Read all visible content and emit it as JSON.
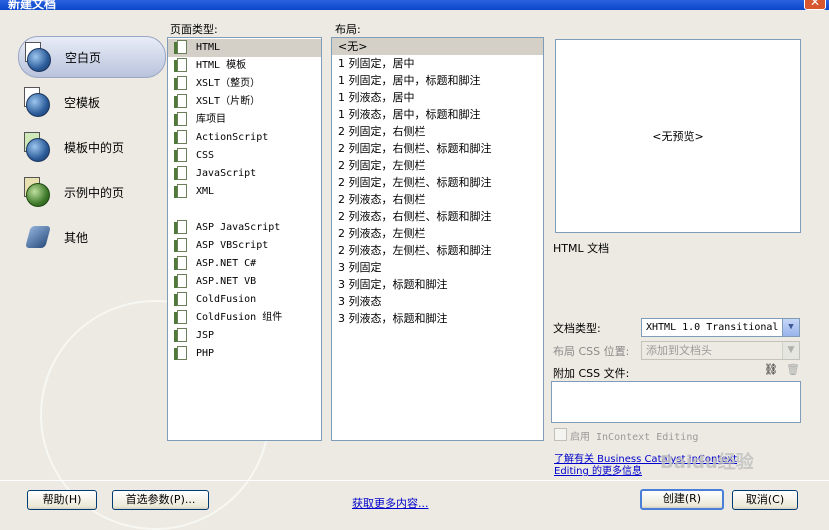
{
  "window": {
    "title": "新建文档",
    "close_glyph": "✕"
  },
  "nav": [
    {
      "label": "空白页",
      "icon": "blank-page-icon",
      "selected": true
    },
    {
      "label": "空模板",
      "icon": "blank-template-icon",
      "selected": false
    },
    {
      "label": "模板中的页",
      "icon": "page-from-template-icon",
      "selected": false
    },
    {
      "label": "示例中的页",
      "icon": "page-from-sample-icon",
      "selected": false
    },
    {
      "label": "其他",
      "icon": "other-icon",
      "selected": false
    }
  ],
  "page_type": {
    "label": "页面类型:",
    "items": [
      "HTML",
      "HTML 模板",
      "XSLT（整页）",
      "XSLT（片断）",
      "库项目",
      "ActionScript",
      "CSS",
      "JavaScript",
      "XML",
      "",
      "ASP JavaScript",
      "ASP VBScript",
      "ASP.NET C#",
      "ASP.NET VB",
      "ColdFusion",
      "ColdFusion 组件",
      "JSP",
      "PHP"
    ],
    "selected_index": 0
  },
  "layout": {
    "label": "布局:",
    "items": [
      "<无>",
      "1 列固定，居中",
      "1 列固定，居中，标题和脚注",
      "1 列液态，居中",
      "1 列液态，居中，标题和脚注",
      "2 列固定，右侧栏",
      "2 列固定，右侧栏、标题和脚注",
      "2 列固定，左侧栏",
      "2 列固定，左侧栏、标题和脚注",
      "2 列液态，右侧栏",
      "2 列液态，右侧栏、标题和脚注",
      "2 列液态，左侧栏",
      "2 列液态，左侧栏、标题和脚注",
      "3 列固定",
      "3 列固定，标题和脚注",
      "3 列液态",
      "3 列液态，标题和脚注"
    ],
    "selected_index": 0
  },
  "preview": {
    "text": "<无预览>",
    "description": "HTML 文档"
  },
  "doctype": {
    "label": "文档类型:",
    "value": "XHTML 1.0 Transitional"
  },
  "layout_css": {
    "label": "布局 CSS 位置:",
    "value": "添加到文档头"
  },
  "attach_css": {
    "label": "附加 CSS 文件:",
    "link_glyph": "⛓",
    "trash_glyph": "🗑"
  },
  "incontext": {
    "label": "启用 InContext Editing"
  },
  "learn_more": {
    "line1": "了解有关 Business Catalyst InContext",
    "line2": "Editing 的更多信息"
  },
  "buttons": {
    "help": "帮助(H)",
    "preferences": "首选参数(P)...",
    "get_more": "获取更多内容...",
    "create": "创建(R)",
    "cancel": "取消(C)"
  },
  "watermark": "Baidu经验"
}
